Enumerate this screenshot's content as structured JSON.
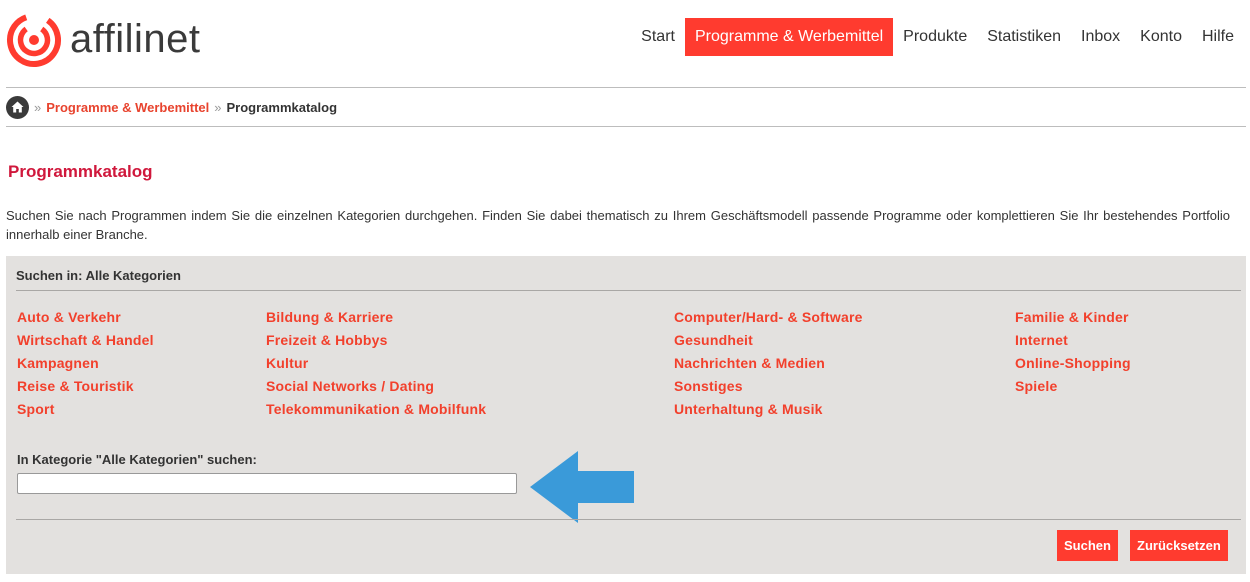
{
  "brand": {
    "name": "affilinet",
    "color": "#ff3b2f"
  },
  "nav": {
    "items": [
      {
        "label": "Start"
      },
      {
        "label": "Programme & Werbemittel",
        "active": true
      },
      {
        "label": "Produkte"
      },
      {
        "label": "Statistiken"
      },
      {
        "label": "Inbox"
      },
      {
        "label": "Konto"
      },
      {
        "label": "Hilfe"
      }
    ]
  },
  "breadcrumb": {
    "separator": "»",
    "link": "Programme & Werbemittel",
    "current": "Programmkatalog"
  },
  "page": {
    "title": "Programmkatalog",
    "description": "Suchen Sie nach Programmen indem Sie die einzelnen Kategorien durchgehen. Finden Sie dabei thematisch zu Ihrem Geschäftsmodell passende Programme oder komplettieren Sie Ihr bestehendes Portfolio innerhalb einer Branche."
  },
  "panel": {
    "heading": "Suchen in: Alle Kategorien",
    "categories": [
      [
        "Auto & Verkehr",
        "Wirtschaft & Handel",
        "Kampagnen",
        "Reise & Touristik",
        "Sport"
      ],
      [
        "Bildung & Karriere",
        "Freizeit & Hobbys",
        "Kultur",
        "Social Networks / Dating",
        "Telekommunikation & Mobilfunk"
      ],
      [
        "Computer/Hard- & Software",
        "Gesundheit",
        "Nachrichten & Medien",
        "Sonstiges",
        "Unterhaltung & Musik"
      ],
      [
        "Familie & Kinder",
        "Internet",
        "Online-Shopping",
        "Spiele"
      ]
    ],
    "search_label": "In Kategorie \"Alle Kategorien\" suchen:",
    "search_value": "",
    "search_placeholder": "",
    "arrow_color": "#3a9ad9",
    "buttons": {
      "search": "Suchen",
      "reset": "Zurücksetzen"
    }
  }
}
